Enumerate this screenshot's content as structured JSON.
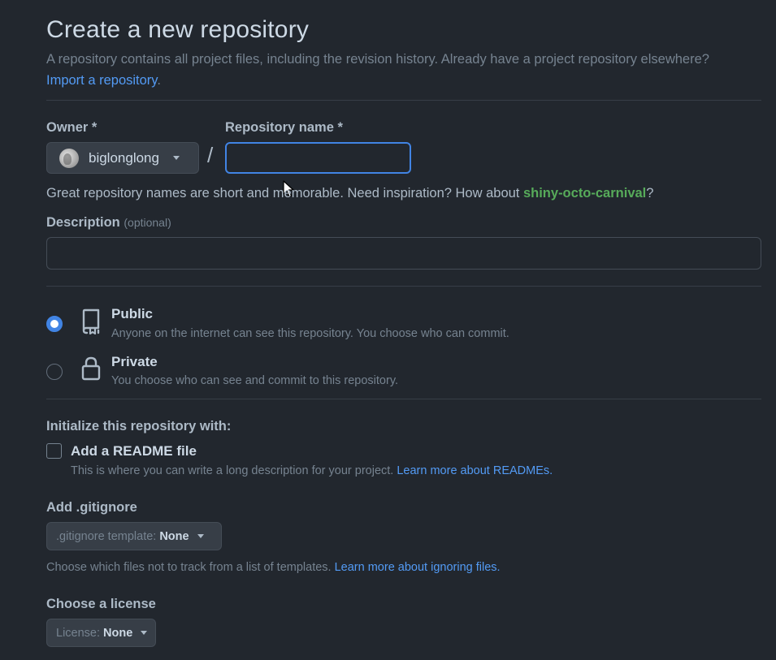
{
  "header": {
    "title": "Create a new repository",
    "subtitle": "A repository contains all project files, including the revision history. Already have a project repository elsewhere?",
    "import_link": "Import a repository",
    "import_suffix": "."
  },
  "owner": {
    "label": "Owner *",
    "value": "biglonglong"
  },
  "repo_name": {
    "label": "Repository name *",
    "value": "",
    "placeholder": ""
  },
  "separator": "/",
  "name_hint": {
    "prefix": "Great repository names are short and memorable. Need inspiration? How about ",
    "suggestion": "shiny-octo-carnival",
    "suffix": "?"
  },
  "description": {
    "label": "Description",
    "optional": "(optional)",
    "value": "",
    "placeholder": ""
  },
  "visibility": {
    "public": {
      "title": "Public",
      "desc": "Anyone on the internet can see this repository. You choose who can commit.",
      "selected": true
    },
    "private": {
      "title": "Private",
      "desc": "You choose who can see and commit to this repository.",
      "selected": false
    }
  },
  "init": {
    "heading": "Initialize this repository with:",
    "readme_label": "Add a README file",
    "readme_checked": false,
    "readme_desc": "This is where you can write a long description for your project.",
    "readme_link": "Learn more about READMEs."
  },
  "gitignore": {
    "heading": "Add .gitignore",
    "prefix": ".gitignore template:",
    "value": "None",
    "desc": "Choose which files not to track from a list of templates.",
    "link": "Learn more about ignoring files."
  },
  "license": {
    "heading": "Choose a license",
    "prefix": "License:",
    "value": "None"
  },
  "colors": {
    "background": "#22272e",
    "accent": "#4184e4",
    "link": "#539bf5",
    "suggestion": "#57ab5a"
  }
}
